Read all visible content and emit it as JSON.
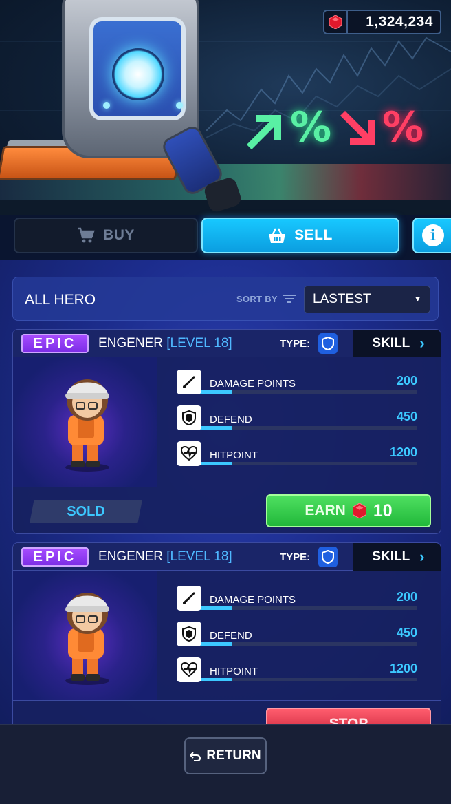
{
  "currency": {
    "value": "1,324,234",
    "icon": "red-gem-icon"
  },
  "banner": {
    "up_symbol": "%",
    "down_symbol": "%"
  },
  "tabs": [
    {
      "label": "BUY",
      "icon": "cart-icon",
      "active": false
    },
    {
      "label": "SELL",
      "icon": "basket-icon",
      "active": true
    }
  ],
  "filter": {
    "title": "ALL HERO",
    "sort_label": "SORT BY",
    "sort_value": "LASTEST"
  },
  "cards": [
    {
      "rarity": "EPIC",
      "name": "ENGENER",
      "level": "[LEVEL 18]",
      "type_label": "TYPE:",
      "skill_label": "SKILL",
      "stats": [
        {
          "label": "DAMAGE POINTS",
          "value": "200",
          "icon": "sword-icon",
          "fill": 0.15
        },
        {
          "label": "DEFEND",
          "value": "450",
          "icon": "shield-icon",
          "fill": 0.15
        },
        {
          "label": "HITPOINT",
          "value": "1200",
          "icon": "heart-pulse-icon",
          "fill": 0.15
        }
      ],
      "status": "SOLD",
      "earn_label": "EARN",
      "earn_amount": "10"
    },
    {
      "rarity": "EPIC",
      "name": "ENGENER",
      "level": "[LEVEL 18]",
      "type_label": "TYPE:",
      "skill_label": "SKILL",
      "stats": [
        {
          "label": "DAMAGE POINTS",
          "value": "200",
          "icon": "sword-icon",
          "fill": 0.15
        },
        {
          "label": "DEFEND",
          "value": "450",
          "icon": "shield-icon",
          "fill": 0.15
        },
        {
          "label": "HITPOINT",
          "value": "1200",
          "icon": "heart-pulse-icon",
          "fill": 0.15
        }
      ],
      "action_label": "STOP"
    }
  ],
  "footer": {
    "return_label": "RETURN"
  },
  "colors": {
    "accent": "#3cc8ff",
    "epic": "#a64cff",
    "earn": "#21b83a",
    "stop": "#c51f35",
    "gem": "#e0192c"
  }
}
